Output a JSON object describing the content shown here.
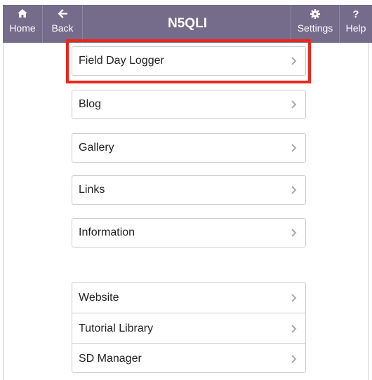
{
  "header": {
    "title": "N5QLI",
    "buttons": {
      "home": {
        "label": "Home",
        "icon": "home-icon"
      },
      "back": {
        "label": "Back",
        "icon": "back-arrow-icon"
      },
      "settings": {
        "label": "Settings",
        "icon": "gear-icon"
      },
      "help": {
        "label": "Help",
        "icon": "question-icon"
      }
    },
    "background_color": "#756b8a"
  },
  "menu": {
    "items": [
      {
        "label": "Field Day Logger",
        "highlighted": true
      },
      {
        "label": "Blog"
      },
      {
        "label": "Gallery"
      },
      {
        "label": "Links"
      },
      {
        "label": "Information"
      }
    ],
    "group": [
      {
        "label": "Website"
      },
      {
        "label": "Tutorial Library"
      },
      {
        "label": "SD Manager"
      }
    ]
  },
  "highlight_color": "#e8281e"
}
